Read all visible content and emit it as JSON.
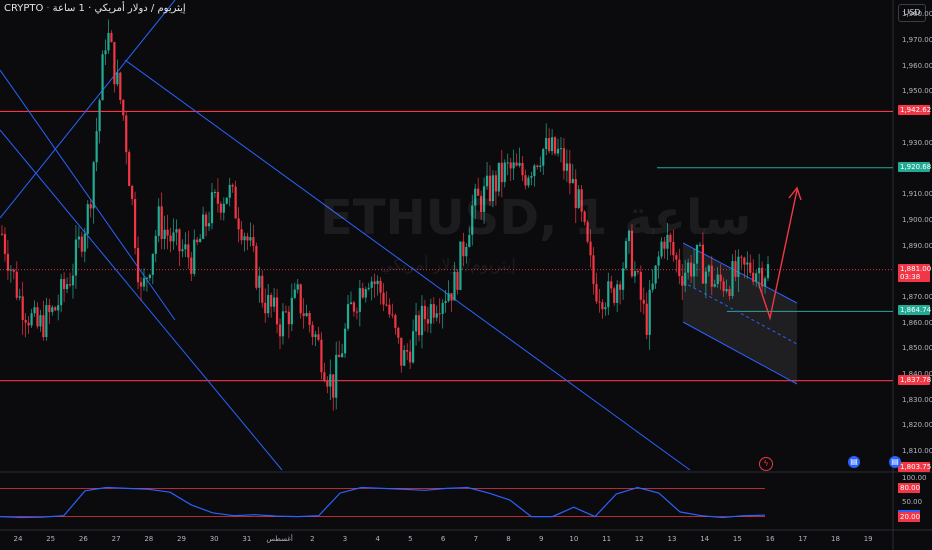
{
  "header": {
    "exchange": "CRYPTO",
    "pair_name": "إيثريوم / دولار أمريكي · 1 ساعة",
    "currency_button": "USD"
  },
  "watermark": {
    "symbol": "ETHUSD, 1 ساعة",
    "name": "إيثريوم/دولار أمريكي"
  },
  "price_axis": {
    "ticks": [
      "1,980.00",
      "1,970.00",
      "1,960.00",
      "1,950.00",
      "1,930.00",
      "1,910.00",
      "1,900.00",
      "1,890.00",
      "1,870.00",
      "1,860.00",
      "1,850.00",
      "1,840.00",
      "1,830.00",
      "1,820.00",
      "1,810.00"
    ]
  },
  "price_tags": [
    {
      "label": "1,942.62",
      "color": "#f23645"
    },
    {
      "label": "1,920.68",
      "color": "#22ab94"
    },
    {
      "label": "1,881.00",
      "sub": "03:38",
      "color": "#f23645"
    },
    {
      "label": "1,864.74",
      "color": "#22ab94"
    },
    {
      "label": "1,837.78",
      "color": "#f23645"
    },
    {
      "label": "1,803.75",
      "color": "#f23645"
    }
  ],
  "time_axis": {
    "ticks": [
      "24",
      "25",
      "26",
      "27",
      "28",
      "29",
      "30",
      "31",
      "أغسطس",
      "2",
      "3",
      "4",
      "5",
      "6",
      "7",
      "8",
      "9",
      "10",
      "11",
      "12",
      "13",
      "14",
      "15",
      "16",
      "17",
      "18",
      "19"
    ]
  },
  "indicator": {
    "ticks": [
      "100.00",
      "80.00",
      "50.00",
      "22.77",
      "20.00"
    ],
    "current": "22.77",
    "tag_colors": {
      "upper": "#f23645",
      "value": "#2962ff",
      "lower": "#f23645"
    }
  },
  "chart_data": {
    "type": "candlestick",
    "symbol": "ETHUSD",
    "timeframe": "1h",
    "levels": {
      "resistance_top": 1942.62,
      "target": 1920.68,
      "last_price": 1881.0,
      "support_green": 1864.74,
      "support_bottom": 1837.78,
      "axis_bottom_tag": 1803.75
    },
    "ylim": [
      1803,
      1986
    ],
    "price_path_keys": [
      1895,
      1870,
      1858,
      1865,
      1880,
      1905,
      1975,
      1940,
      1870,
      1900,
      1890,
      1885,
      1905,
      1912,
      1895,
      1870,
      1860,
      1870,
      1855,
      1835,
      1865,
      1880,
      1870,
      1845,
      1860,
      1870,
      1875,
      1905,
      1912,
      1920,
      1918,
      1928,
      1926,
      1910,
      1875,
      1870,
      1890,
      1860,
      1895,
      1880,
      1885,
      1875,
      1878,
      1882,
      1881
    ],
    "indicator_values": [
      20,
      18,
      19,
      22,
      75,
      82,
      80,
      78,
      72,
      45,
      28,
      22,
      24,
      21,
      20,
      22,
      70,
      82,
      80,
      78,
      76,
      80,
      82,
      70,
      55,
      20,
      20,
      40,
      20,
      68,
      82,
      70,
      30,
      22,
      18,
      22,
      23
    ]
  },
  "colors": {
    "background": "#0b0b0d",
    "up": "#22ab94",
    "down": "#f23645",
    "trend_line": "#2962ff",
    "level_red": "#f23645",
    "level_green": "#22ab94",
    "indicator_line": "#2962ff"
  }
}
